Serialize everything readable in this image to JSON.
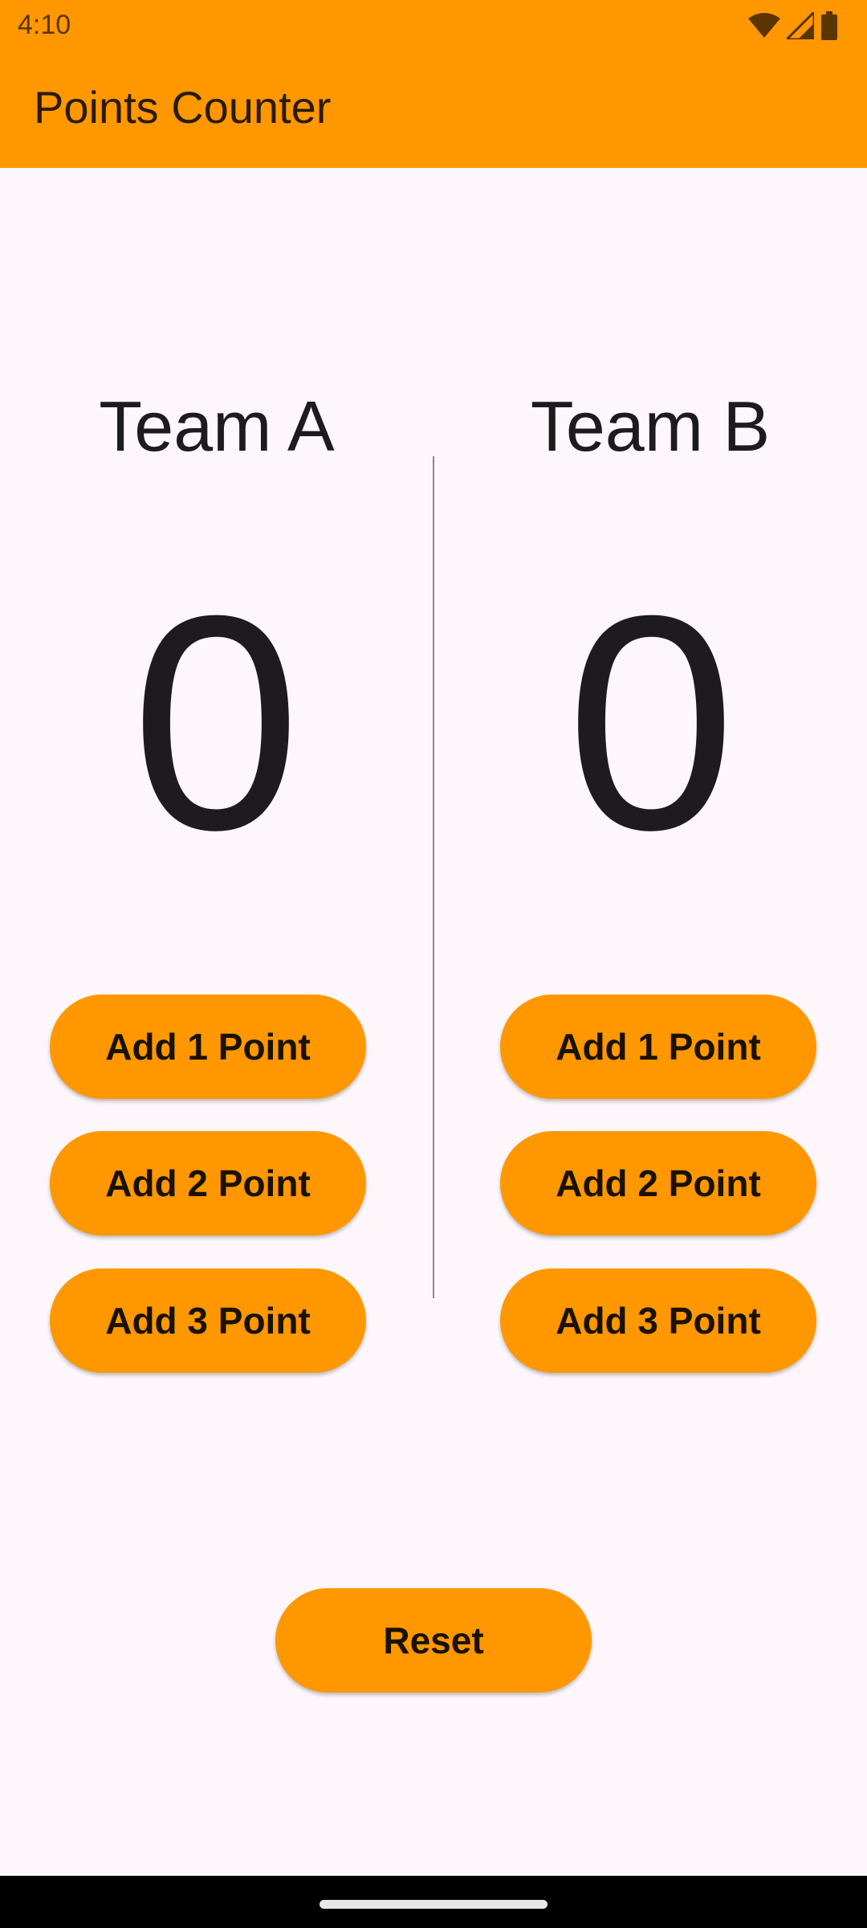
{
  "status_bar": {
    "time": "4:10",
    "icons": [
      "wifi-icon",
      "signal-icon",
      "battery-icon"
    ]
  },
  "app_bar": {
    "title": "Points Counter"
  },
  "team_a": {
    "name": "Team A",
    "score": "0",
    "buttons": [
      "Add 1 Point",
      "Add 2 Point",
      "Add 3 Point"
    ]
  },
  "team_b": {
    "name": "Team B",
    "score": "0",
    "buttons": [
      "Add 1 Point",
      "Add 2 Point",
      "Add 3 Point"
    ]
  },
  "reset_label": "Reset",
  "colors": {
    "accent": "#ff9800",
    "background": "#fdf7fb",
    "text": "#1d1b20"
  }
}
